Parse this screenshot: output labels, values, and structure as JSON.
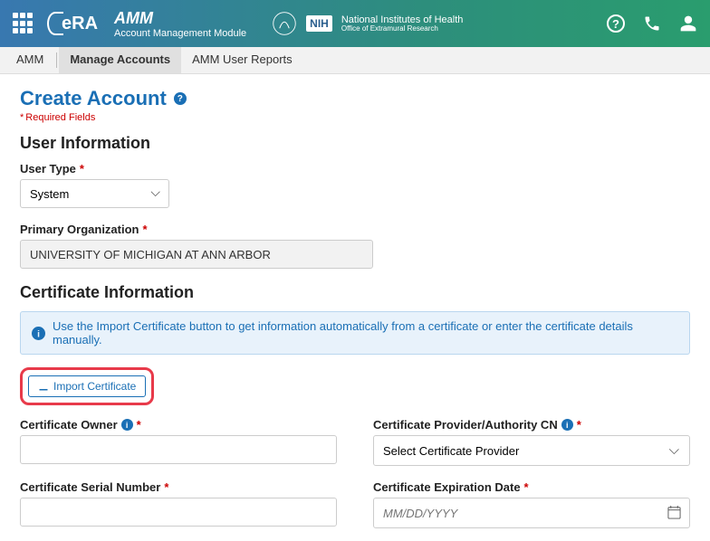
{
  "header": {
    "app_abbr": "AMM",
    "app_name": "Account Management Module",
    "era": "eRA",
    "nih_abbr": "NIH",
    "nih_title": "National Institutes of Health",
    "nih_sub": "Office of Extramural Research"
  },
  "tabs": {
    "t0": "AMM",
    "t1": "Manage Accounts",
    "t2": "AMM User Reports"
  },
  "page": {
    "title": "Create Account",
    "required_note": "Required Fields"
  },
  "user_info": {
    "section_title": "User Information",
    "user_type_label": "User Type",
    "user_type_value": "System",
    "primary_org_label": "Primary Organization",
    "primary_org_value": "UNIVERSITY OF MICHIGAN AT ANN ARBOR"
  },
  "cert_info": {
    "section_title": "Certificate Information",
    "banner": "Use the Import Certificate button to get information automatically from a certificate or enter the certificate details manually.",
    "import_label": "Import Certificate",
    "owner_label": "Certificate Owner",
    "provider_label": "Certificate Provider/Authority CN",
    "provider_placeholder": "Select Certificate Provider",
    "serial_label": "Certificate Serial Number",
    "exp_label": "Certificate Expiration Date",
    "exp_placeholder": "MM/DD/YYYY"
  }
}
